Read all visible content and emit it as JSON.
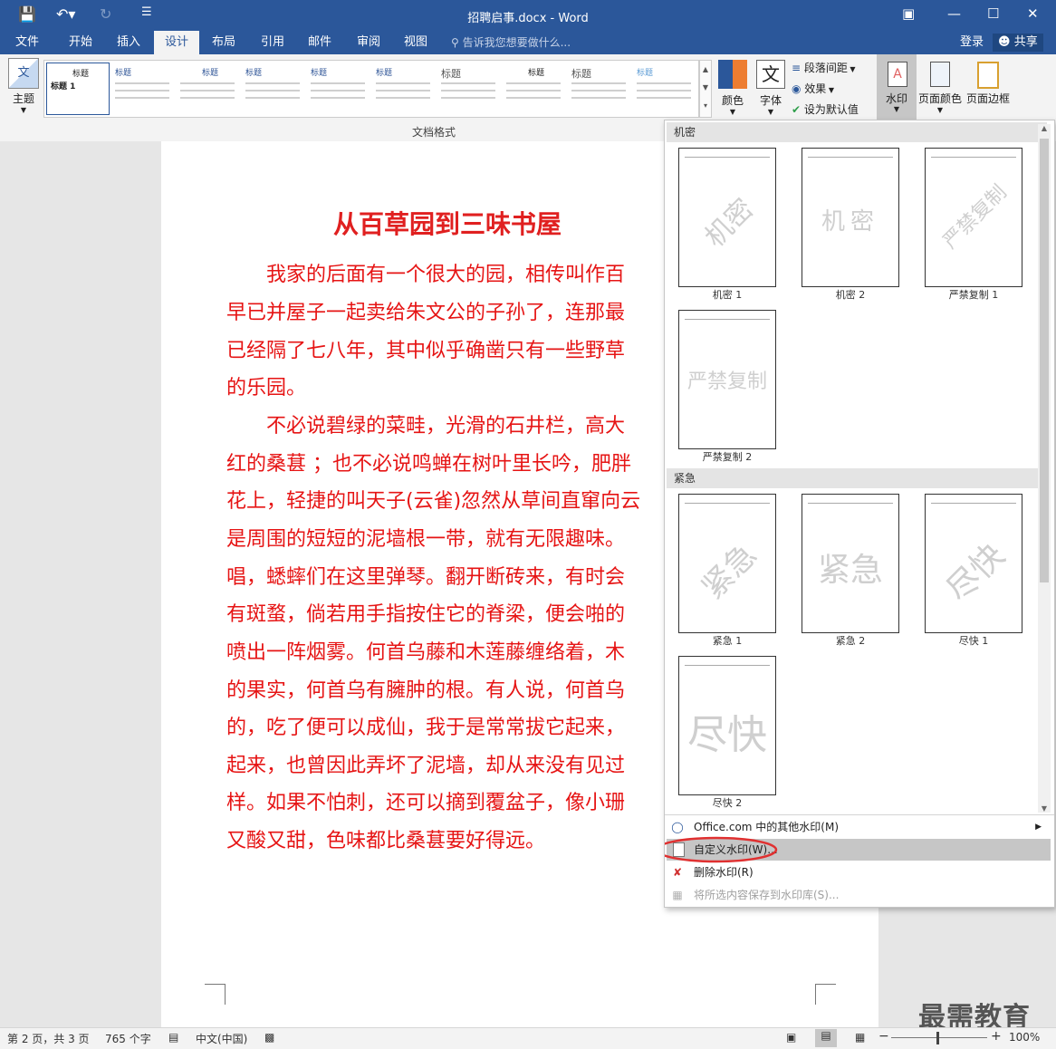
{
  "titlebar": {
    "title": "招聘启事.docx - Word",
    "save_icon": "save-icon",
    "undo_icon": "undo-icon",
    "redo_icon": "redo-icon",
    "customize_icon": "customize-icon"
  },
  "tabs": [
    "文件",
    "开始",
    "插入",
    "设计",
    "布局",
    "引用",
    "邮件",
    "审阅",
    "视图"
  ],
  "active_tab": "设计",
  "tellme": "告诉我您想要做什么...",
  "login": "登录",
  "share": "共享",
  "ribbon": {
    "theme": "主题",
    "gallery_label": "文档格式",
    "thumb_title": "标题",
    "first_thumb_heading": "标题 1",
    "colors": "颜色",
    "fonts": "字体",
    "paragraph_spacing": "段落间距",
    "effects": "效果",
    "set_default": "设为默认值",
    "watermark": "水印",
    "page_color": "页面颜色",
    "page_border": "页面边框",
    "font_glyph": "文"
  },
  "document": {
    "heading": "从百草园到三味书屋",
    "lines": [
      "　　我家的后面有一个很大的园，相传叫作百",
      "早已并屋子一起卖给朱文公的子孙了，连那最",
      "已经隔了七八年，其中似乎确凿只有一些野草",
      "的乐园。",
      "　　不必说碧绿的菜畦，光滑的石井栏，高大",
      "红的桑葚 ；也不必说鸣蝉在树叶里长吟，肥胖",
      "花上，轻捷的叫天子(云雀)忽然从草间直窜向云",
      "是周围的短短的泥墙根一带，就有无限趣味。",
      "唱，蟋蟀们在这里弹琴。翻开断砖来，有时会",
      "有斑蝥，倘若用手指按住它的脊梁，便会啪的",
      "喷出一阵烟雾。何首乌藤和木莲藤缠络着，木",
      "的果实，何首乌有臃肿的根。有人说，何首乌",
      "的，吃了便可以成仙，我于是常常拔它起来，",
      "起来，也曾因此弄坏了泥墙，却从来没有见过",
      "样。如果不怕刺，还可以摘到覆盆子，像小珊",
      "又酸又甜，色味都比桑葚要好得远。"
    ]
  },
  "watermark_menu": {
    "section1": "机密",
    "section2": "紧急",
    "items1": [
      {
        "caption": "机密 1",
        "text": "机密"
      },
      {
        "caption": "机密 2",
        "text": "机密"
      },
      {
        "caption": "严禁复制 1",
        "text": "严禁复制"
      },
      {
        "caption": "严禁复制 2",
        "text": "严禁复制"
      }
    ],
    "items2": [
      {
        "caption": "紧急 1",
        "text": "紧急"
      },
      {
        "caption": "紧急 2",
        "text": "紧急"
      },
      {
        "caption": "尽快 1",
        "text": "尽快"
      },
      {
        "caption": "尽快 2",
        "text": "尽快"
      }
    ],
    "more": "Office.com 中的其他水印(M)",
    "custom": "自定义水印(W)...",
    "remove": "删除水印(R)",
    "save_selection": "将所选内容保存到水印库(S)..."
  },
  "status": {
    "page": "第 2 页，共 3 页",
    "words": "765 个字",
    "language": "中文(中国)",
    "zoom": "100%"
  },
  "brand": "最需教育",
  "colors": {
    "accent": "#2b579a",
    "text_red": "#e61414",
    "highlight_ring": "#e03030"
  }
}
